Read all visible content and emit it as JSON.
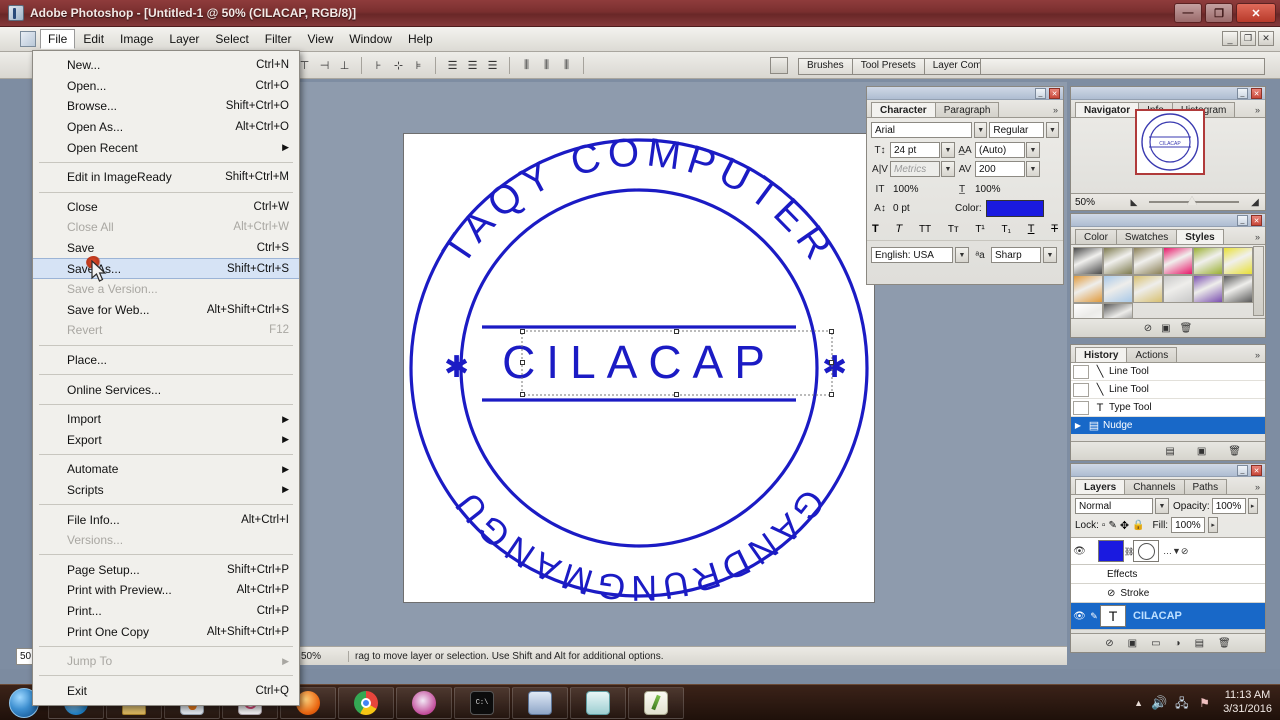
{
  "window": {
    "app_name": "Adobe Photoshop",
    "title": "Adobe Photoshop - [Untitled-1 @ 50% (CILACAP, RGB/8)]",
    "minimize_label": "—",
    "maximize_label": "❐",
    "close_label": "✕",
    "doc_minimize_label": "_",
    "doc_restore_label": "❐",
    "doc_close_label": "✕"
  },
  "menubar": {
    "items": [
      {
        "label": "File",
        "active": true
      },
      {
        "label": "Edit",
        "active": false
      },
      {
        "label": "Image",
        "active": false
      },
      {
        "label": "Layer",
        "active": false
      },
      {
        "label": "Select",
        "active": false
      },
      {
        "label": "Filter",
        "active": false
      },
      {
        "label": "View",
        "active": false
      },
      {
        "label": "Window",
        "active": false
      },
      {
        "label": "Help",
        "active": false
      }
    ]
  },
  "file_menu": {
    "groups": [
      {
        "items": [
          {
            "label": "New...",
            "accel": "Ctrl+N",
            "disabled": false,
            "submenu": false,
            "highlight": false
          },
          {
            "label": "Open...",
            "accel": "Ctrl+O",
            "disabled": false,
            "submenu": false,
            "highlight": false
          },
          {
            "label": "Browse...",
            "accel": "Shift+Ctrl+O",
            "disabled": false,
            "submenu": false,
            "highlight": false
          },
          {
            "label": "Open As...",
            "accel": "Alt+Ctrl+O",
            "disabled": false,
            "submenu": false,
            "highlight": false
          },
          {
            "label": "Open Recent",
            "accel": "",
            "disabled": false,
            "submenu": true,
            "highlight": false
          }
        ]
      },
      {
        "items": [
          {
            "label": "Edit in ImageReady",
            "accel": "Shift+Ctrl+M",
            "disabled": false,
            "submenu": false,
            "highlight": false
          }
        ]
      },
      {
        "items": [
          {
            "label": "Close",
            "accel": "Ctrl+W",
            "disabled": false,
            "submenu": false,
            "highlight": false
          },
          {
            "label": "Close All",
            "accel": "Alt+Ctrl+W",
            "disabled": true,
            "submenu": false,
            "highlight": false
          },
          {
            "label": "Save",
            "accel": "Ctrl+S",
            "disabled": false,
            "submenu": false,
            "highlight": false
          },
          {
            "label": "Save As...",
            "accel": "Shift+Ctrl+S",
            "disabled": false,
            "submenu": false,
            "highlight": true
          },
          {
            "label": "Save a Version...",
            "accel": "",
            "disabled": true,
            "submenu": false,
            "highlight": false
          },
          {
            "label": "Save for Web...",
            "accel": "Alt+Shift+Ctrl+S",
            "disabled": false,
            "submenu": false,
            "highlight": false
          },
          {
            "label": "Revert",
            "accel": "F12",
            "disabled": true,
            "submenu": false,
            "highlight": false
          }
        ]
      },
      {
        "items": [
          {
            "label": "Place...",
            "accel": "",
            "disabled": false,
            "submenu": false,
            "highlight": false
          }
        ]
      },
      {
        "items": [
          {
            "label": "Online Services...",
            "accel": "",
            "disabled": false,
            "submenu": false,
            "highlight": false
          }
        ]
      },
      {
        "items": [
          {
            "label": "Import",
            "accel": "",
            "disabled": false,
            "submenu": true,
            "highlight": false
          },
          {
            "label": "Export",
            "accel": "",
            "disabled": false,
            "submenu": true,
            "highlight": false
          }
        ]
      },
      {
        "items": [
          {
            "label": "Automate",
            "accel": "",
            "disabled": false,
            "submenu": true,
            "highlight": false
          },
          {
            "label": "Scripts",
            "accel": "",
            "disabled": false,
            "submenu": true,
            "highlight": false
          }
        ]
      },
      {
        "items": [
          {
            "label": "File Info...",
            "accel": "Alt+Ctrl+I",
            "disabled": false,
            "submenu": false,
            "highlight": false
          },
          {
            "label": "Versions...",
            "accel": "",
            "disabled": true,
            "submenu": false,
            "highlight": false
          }
        ]
      },
      {
        "items": [
          {
            "label": "Page Setup...",
            "accel": "Shift+Ctrl+P",
            "disabled": false,
            "submenu": false,
            "highlight": false
          },
          {
            "label": "Print with Preview...",
            "accel": "Alt+Ctrl+P",
            "disabled": false,
            "submenu": false,
            "highlight": false
          },
          {
            "label": "Print...",
            "accel": "Ctrl+P",
            "disabled": false,
            "submenu": false,
            "highlight": false
          },
          {
            "label": "Print One Copy",
            "accel": "Alt+Shift+Ctrl+P",
            "disabled": false,
            "submenu": false,
            "highlight": false
          }
        ]
      },
      {
        "items": [
          {
            "label": "Jump To",
            "accel": "",
            "disabled": true,
            "submenu": true,
            "highlight": false
          }
        ]
      },
      {
        "items": [
          {
            "label": "Exit",
            "accel": "Ctrl+Q",
            "disabled": false,
            "submenu": false,
            "highlight": false
          }
        ]
      }
    ]
  },
  "options_bar": {
    "align_icons": [
      "align-top-edges",
      "align-vertical-centers",
      "align-bottom-edges",
      "align-left-edges",
      "align-horizontal-centers",
      "align-right-edges"
    ],
    "distribute_icons": [
      "distribute-top-edges",
      "distribute-vertical-centers",
      "distribute-bottom-edges",
      "distribute-left-edges",
      "distribute-horizontal-centers",
      "distribute-right-edges"
    ]
  },
  "palette_well": {
    "tabs": [
      "Brushes",
      "Tool Presets",
      "Layer Comps"
    ]
  },
  "toolbox": {
    "tools": [
      "marquee-tool",
      "lasso-tool",
      "crop-tool",
      "healing-brush-tool",
      "clone-stamp-tool",
      "eraser-tool",
      "gradient-tool",
      "path-selection-tool",
      "pen-tool",
      "notes-tool",
      "hand-tool"
    ],
    "foreground_color": "#1a1ae0"
  },
  "canvas": {
    "stamp": {
      "top_arc_text": "TAQY COMPUTER",
      "bottom_arc_text": "GANDRUNGMANGU",
      "center_text": "CILACAP",
      "left_star": "✱",
      "right_star": "✱",
      "ink_color": "#1b1bc4"
    }
  },
  "status_bar": {
    "zoom": "50%",
    "message": "rag to move layer or selection.  Use Shift and Alt for additional options."
  },
  "zoom_field": {
    "value": "50"
  },
  "character_panel": {
    "tabs": [
      {
        "label": "Character",
        "on": true
      },
      {
        "label": "Paragraph",
        "on": false
      }
    ],
    "more_glyph": "»",
    "font_family": "Arial",
    "font_style": "Regular",
    "font_size": "24 pt",
    "leading": "(Auto)",
    "kerning": "Metrics",
    "tracking": "200",
    "vertical_scale": "100%",
    "horizontal_scale": "100%",
    "baseline_shift": "0 pt",
    "color_label": "Color:",
    "color_value": "#1a1ae0",
    "style_buttons": [
      "faux-bold",
      "faux-italic",
      "all-caps",
      "small-caps",
      "superscript",
      "subscript",
      "underline",
      "strikethrough"
    ],
    "language": "English: USA",
    "antialias_label": "Sharp",
    "antialias_icon": "aa-icon"
  },
  "navigator_panel": {
    "tabs": [
      {
        "label": "Navigator",
        "on": true
      },
      {
        "label": "Info",
        "on": false
      },
      {
        "label": "Histogram",
        "on": false
      }
    ],
    "more_glyph": "»",
    "zoom_value": "50%"
  },
  "styles_panel": {
    "tabs": [
      {
        "label": "Color",
        "on": false
      },
      {
        "label": "Swatches",
        "on": false
      },
      {
        "label": "Styles",
        "on": true
      }
    ],
    "more_glyph": "»",
    "swatches": [
      "#4a4a4a",
      "#7d7a4e",
      "#8a7f55",
      "#e8186a",
      "#9bb033",
      "#e8e034",
      "#e09a3c",
      "#a8c8e8",
      "#d8c070",
      "#c8c8c8",
      "#7a4fb0",
      "#5a5a5a",
      "#ffffff",
      "#5b5b5b"
    ]
  },
  "history_panel": {
    "tabs": [
      {
        "label": "History",
        "on": true
      },
      {
        "label": "Actions",
        "on": false
      }
    ],
    "more_glyph": "»",
    "items": [
      {
        "label": "Line Tool",
        "icon": "line-tool-icon",
        "selected": false
      },
      {
        "label": "Line Tool",
        "icon": "line-tool-icon",
        "selected": false
      },
      {
        "label": "Type Tool",
        "icon": "type-tool-icon",
        "selected": false
      },
      {
        "label": "Nudge",
        "icon": "nudge-icon",
        "selected": true
      }
    ],
    "footer_icons": [
      "new-document-icon",
      "new-snapshot-icon",
      "delete-icon"
    ]
  },
  "layers_panel": {
    "tabs": [
      {
        "label": "Layers",
        "on": true
      },
      {
        "label": "Channels",
        "on": false
      },
      {
        "label": "Paths",
        "on": false
      }
    ],
    "more_glyph": "»",
    "blend_mode": "Normal",
    "opacity_label": "Opacity:",
    "opacity_value": "100%",
    "lock_label": "Lock:",
    "lock_icons": [
      "lock-transparent-pixels",
      "lock-image-pixels",
      "lock-position",
      "lock-all"
    ],
    "fill_label": "Fill:",
    "fill_value": "100%",
    "rows": [
      {
        "label": "",
        "type": "shape-layer",
        "selected": false
      },
      {
        "label": "Effects",
        "type": "effects-group",
        "selected": false
      },
      {
        "label": "Stroke",
        "type": "effect",
        "selected": false
      },
      {
        "label": "CILACAP",
        "type": "type-layer",
        "selected": true
      }
    ],
    "footer_icons": [
      "link-layers-icon",
      "add-layer-style-icon",
      "add-mask-icon",
      "new-fill-adjustment-icon",
      "new-group-icon",
      "new-layer-icon",
      "delete-layer-icon"
    ]
  },
  "taskbar": {
    "start_label": "start",
    "items": [
      {
        "name": "internet-explorer"
      },
      {
        "name": "windows-explorer"
      },
      {
        "name": "app-orange"
      },
      {
        "name": "app-pink"
      },
      {
        "name": "firefox"
      },
      {
        "name": "google-chrome"
      },
      {
        "name": "app-swirl"
      },
      {
        "name": "command-prompt"
      },
      {
        "name": "media-player"
      },
      {
        "name": "app-teal"
      },
      {
        "name": "app-notes"
      }
    ],
    "tray": {
      "show_hidden_glyph": "▲",
      "volume_icon": "volume-icon",
      "network_icon": "network-icon",
      "action_center_icon": "action-center-icon",
      "time": "11:13 AM",
      "date": "3/31/2016"
    }
  }
}
